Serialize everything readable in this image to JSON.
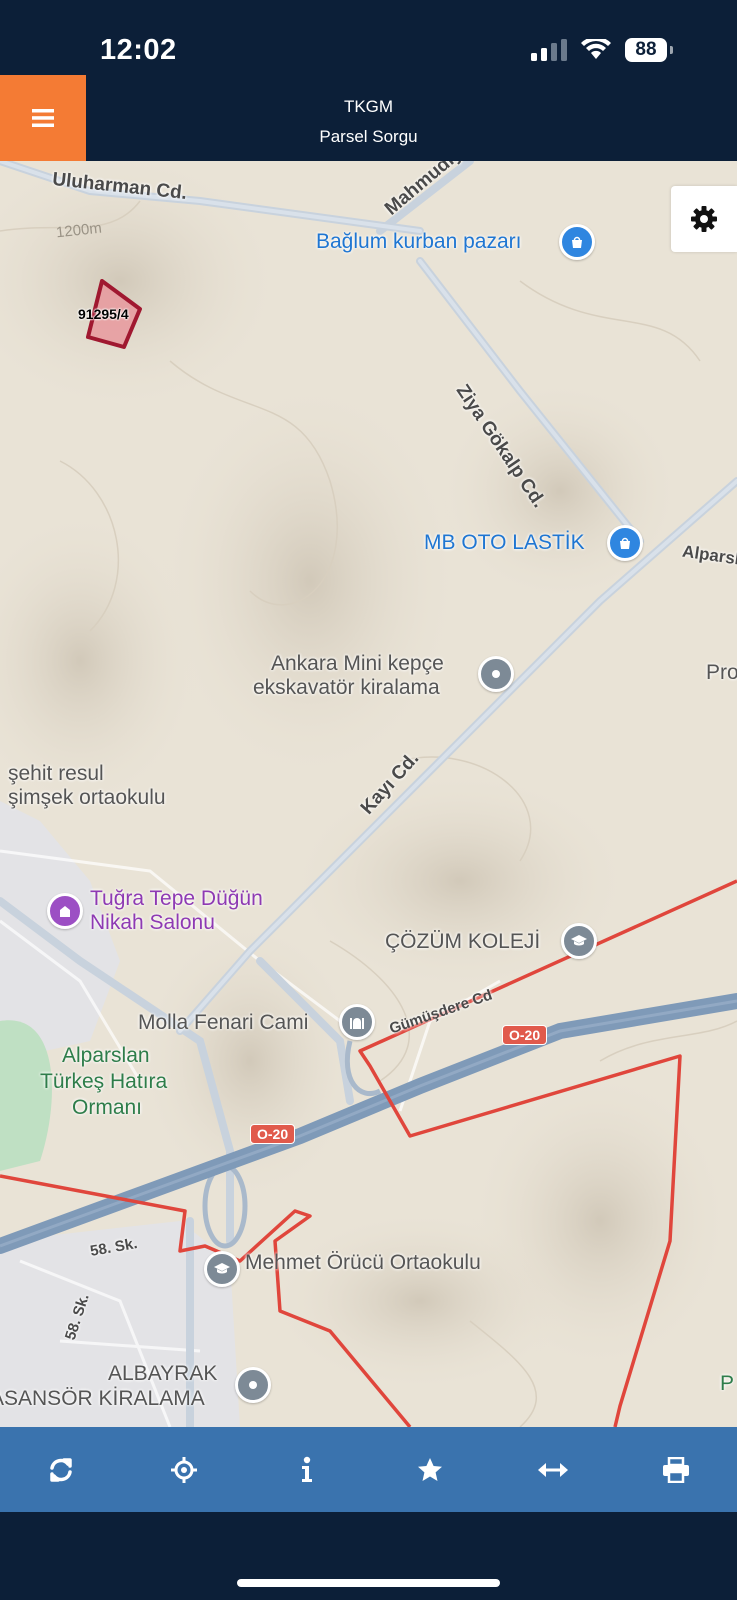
{
  "status_bar": {
    "time": "12:02",
    "battery": "88"
  },
  "header": {
    "title": "TKGM",
    "subtitle": "Parsel Sorgu"
  },
  "map": {
    "parcel_label": "91295/4",
    "contour_label": "1200m",
    "roads": [
      "Uluharman Cd.",
      "Mahmudiye",
      "Ziya Gökalp Cd.",
      "Kayı Cd.",
      "Gümüşdere Cd",
      "Alparslan",
      "58. Sk.",
      "58. Sk."
    ],
    "highway_shield": "O-20",
    "pois": {
      "baglum": "Bağlum kurban pazarı",
      "mb_oto": "MB OTO LASTİK",
      "ankara_mini_1": "Ankara Mini kepçe",
      "ankara_mini_2": "ekskavatör kiralama",
      "sehit_1": "şehit resul",
      "sehit_2": "şimşek ortaokulu",
      "tugra_1": "Tuğra Tepe Düğün",
      "tugra_2": "Nikah Salonu",
      "cozum": "ÇÖZÜM KOLEJİ",
      "molla": "Molla Fenari Cami",
      "park_1": "Alparslan",
      "park_2": "Türkeş Hatıra",
      "park_3": "Ormanı",
      "mehmet": "Mehmet Örücü Ortaokulu",
      "albayrak_1": "ALBAYRAK",
      "albayrak_2": "ASANSÖR KİRALAMA",
      "pro": "Pro",
      "p": "P"
    },
    "colors": {
      "boundary": "#e0463c",
      "parcel_fill": "#e8959b",
      "parcel_stroke": "#a01830",
      "highway": "#7f9ab8"
    }
  },
  "toolbar": {
    "tools": [
      "refresh-icon",
      "locate-icon",
      "info-icon",
      "star-icon",
      "measure-icon",
      "print-icon"
    ]
  }
}
